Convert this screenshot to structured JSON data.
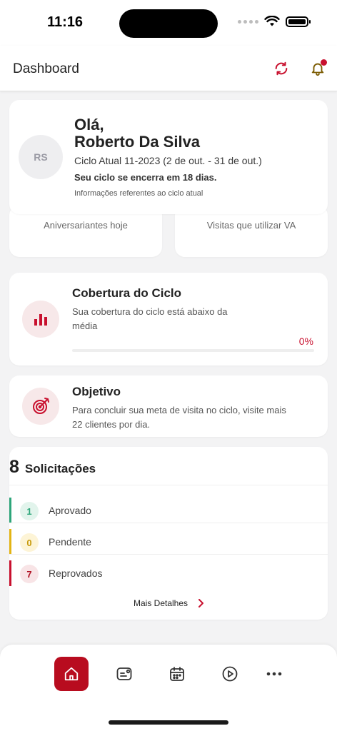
{
  "status_bar": {
    "time": "11:16"
  },
  "header": {
    "title": "Dashboard",
    "icons": [
      "sync-icon",
      "bell-icon"
    ]
  },
  "colors": {
    "brand": "#b80c1f",
    "approved": "#2ea57a",
    "pending": "#e3b414",
    "rejected": "#c8102e"
  },
  "greeting": {
    "avatar_initials": "RS",
    "hello": "Olá,",
    "name": "Roberto Da Silva",
    "cycle": "Ciclo Atual 11-2023 (2 de out. - 31 de out.)",
    "ends_prefix": "Seu ciclo se encerra em ",
    "ends_days": "18 dias.",
    "info": "Informações referentes ao ciclo atual"
  },
  "hidden_cards": {
    "left": "Aniversariantes hoje",
    "right": "Visitas que utilizar VA"
  },
  "coverage": {
    "title": "Cobertura do Ciclo",
    "description": "Sua cobertura do ciclo está abaixo da média",
    "percent_label": "0%",
    "progress": 0
  },
  "objective": {
    "title": "Objetivo",
    "description": "Para concluir sua meta de visita no ciclo, visite mais 22 clientes por dia."
  },
  "requests": {
    "count": "8",
    "label": "Solicitações",
    "rows": [
      {
        "count": "1",
        "label": "Aprovado"
      },
      {
        "count": "0",
        "label": "Pendente"
      },
      {
        "count": "7",
        "label": "Reprovados"
      }
    ],
    "more_details": "Mais Detalhes"
  },
  "bottom_nav": {
    "items": [
      "home-icon",
      "profile-card-icon",
      "calendar-icon",
      "play-icon",
      "more-icon"
    ],
    "active": "home-icon"
  }
}
